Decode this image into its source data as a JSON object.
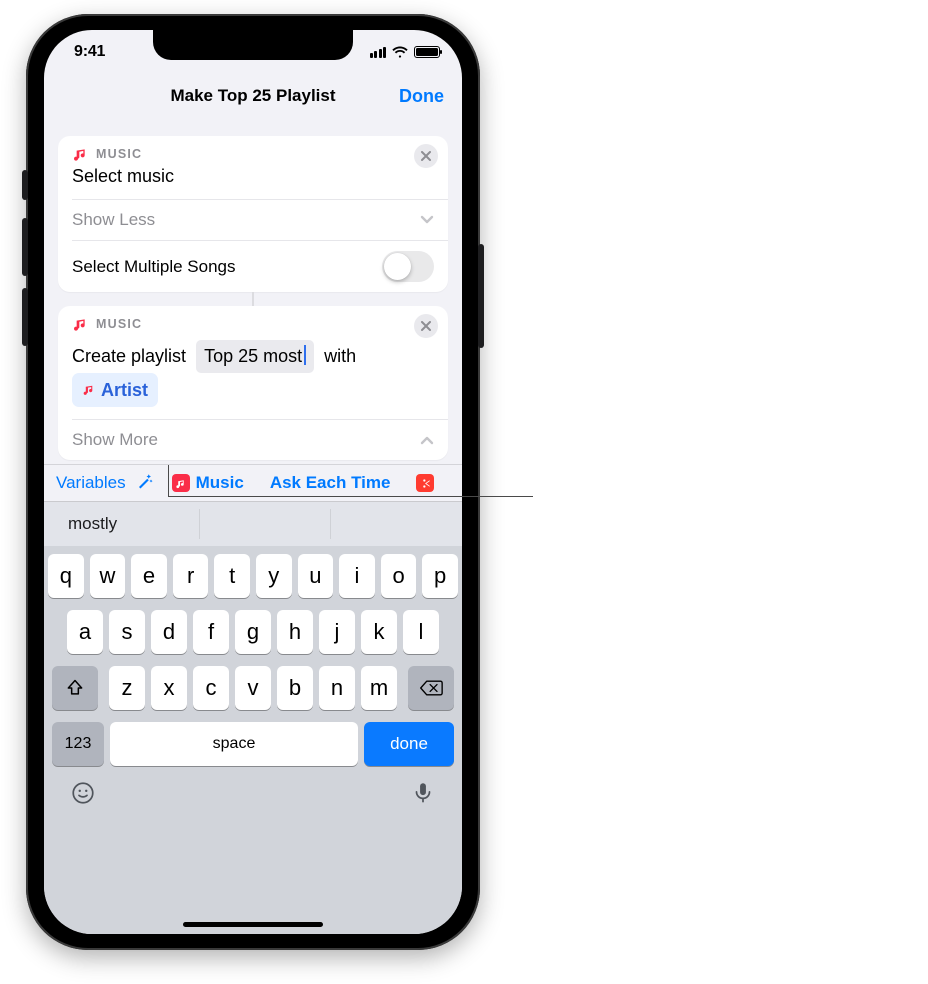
{
  "status": {
    "time": "9:41"
  },
  "nav": {
    "title": "Make Top 25 Playlist",
    "done": "Done"
  },
  "card1": {
    "app": "MUSIC",
    "title": "Select music",
    "showless": "Show Less",
    "row_label": "Select Multiple Songs"
  },
  "card2": {
    "app": "MUSIC",
    "prefix": "Create playlist",
    "token": "Top 25 most",
    "mid": "with",
    "chip": "Artist",
    "showmore": "Show More"
  },
  "varbar": {
    "variables": "Variables",
    "music_pill": "Music",
    "ask_pill": "Ask Each Time"
  },
  "suggest": {
    "w1": "mostly"
  },
  "keyboard": {
    "row1": [
      "q",
      "w",
      "e",
      "r",
      "t",
      "y",
      "u",
      "i",
      "o",
      "p"
    ],
    "row2": [
      "a",
      "s",
      "d",
      "f",
      "g",
      "h",
      "j",
      "k",
      "l"
    ],
    "row3": [
      "z",
      "x",
      "c",
      "v",
      "b",
      "n",
      "m"
    ],
    "k123": "123",
    "space": "space",
    "done": "done"
  }
}
